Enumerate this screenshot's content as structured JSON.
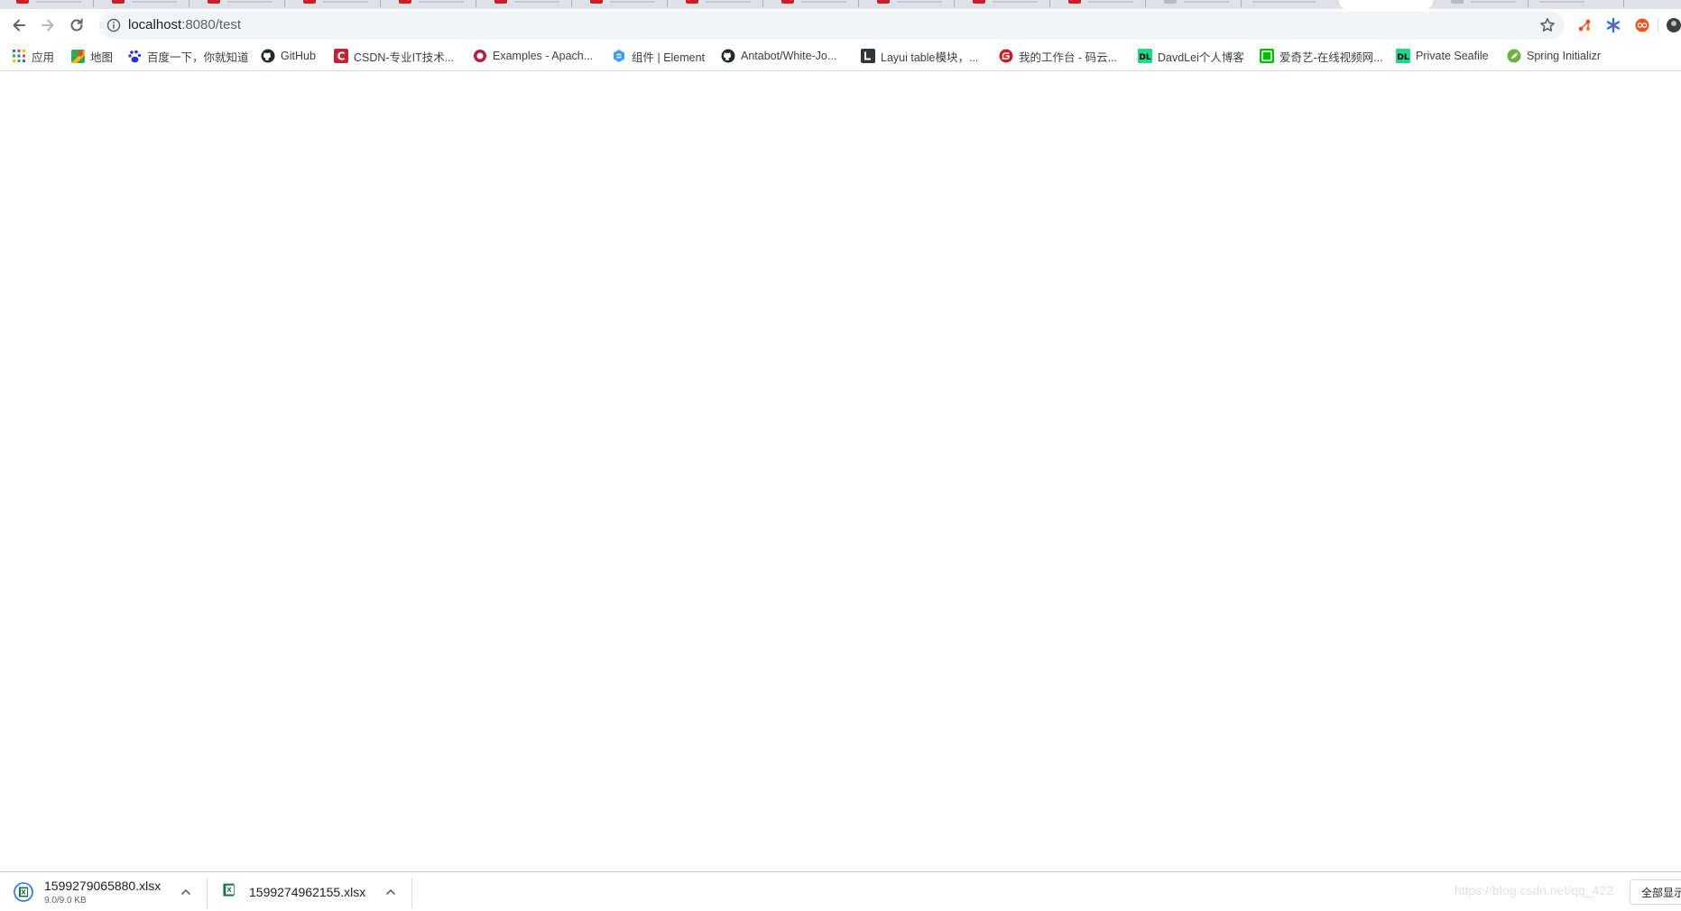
{
  "address_bar": {
    "host": "localhost",
    "path": ":8080/test"
  },
  "bookmarks": [
    {
      "label": "应用",
      "icon": "apps-grid-icon"
    },
    {
      "label": "地图",
      "icon": "maps-icon"
    },
    {
      "label": "百度一下，你就知道",
      "icon": "baidu-paw-icon"
    },
    {
      "label": "GitHub",
      "icon": "github-icon"
    },
    {
      "label": "CSDN-专业IT技术...",
      "icon": "csdn-icon"
    },
    {
      "label": "Examples - Apach...",
      "icon": "apache-icon"
    },
    {
      "label": "组件 | Element",
      "icon": "element-icon"
    },
    {
      "label": "Antabot/White-Jo...",
      "icon": "github-icon"
    },
    {
      "label": "Layui table模块，...",
      "icon": "layui-icon"
    },
    {
      "label": "我的工作台 - 码云...",
      "icon": "gitee-icon"
    },
    {
      "label": "DavdLei个人博客",
      "icon": "dl-blog-icon"
    },
    {
      "label": "爱奇艺-在线视频网...",
      "icon": "iqiyi-icon"
    },
    {
      "label": "Private Seafile",
      "icon": "dl-blog-icon"
    },
    {
      "label": "Spring Initializr",
      "icon": "spring-icon"
    }
  ],
  "downloads": [
    {
      "filename": "1599279065880.xlsx",
      "size": "9.0/9.0 KB"
    },
    {
      "filename": "1599274962155.xlsx",
      "size": ""
    }
  ],
  "watermark": "https://blog.csdn.net/qq_422",
  "show_all_label": "全部显示"
}
